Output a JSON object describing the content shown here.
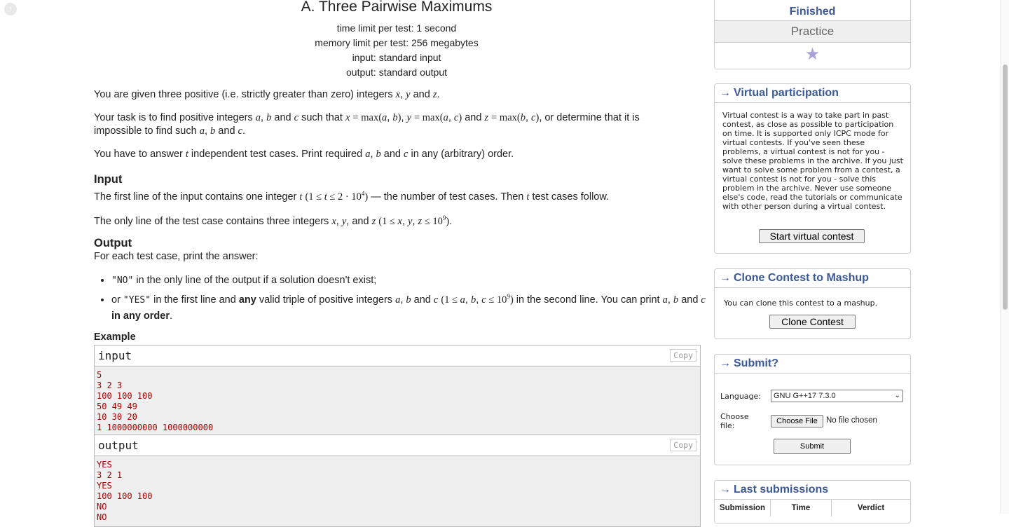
{
  "problem": {
    "title": "A. Three Pairwise Maximums",
    "limits": [
      "time limit per test: 1 second",
      "memory limit per test: 256 megabytes",
      "input: standard input",
      "output: standard output"
    ],
    "statement_1_pre": "You are given three positive (i.e. strictly greater than zero) integers ",
    "statement_2_pre": "Your task is to find positive integers ",
    "statement_2_mid": " such that ",
    "statement_2_post": ", or determine that it is impossible to find such ",
    "statement_3_pre": "You have to answer ",
    "statement_3_mid": " independent test cases. Print required ",
    "statement_3_post": " in any (arbitrary) order.",
    "input_heading": "Input",
    "input_1_pre": "The first line of the input contains one integer ",
    "input_1_post": " — the number of test cases. Then ",
    "input_1_end": " test cases follow.",
    "input_2_pre": "The only line of the test case contains three integers ",
    "output_heading": "Output",
    "output_intro": "For each test case, print the answer:",
    "bullet_1_q": "\"NO\"",
    "bullet_1_rest": " in the only line of the output if a solution doesn't exist;",
    "bullet_2_pre": "or ",
    "bullet_2_q": "\"YES\"",
    "bullet_2_a": " in the first line and ",
    "bullet_2_any": "any",
    "bullet_2_b": " valid triple of positive integers ",
    "bullet_2_c": " in the second line. You can print ",
    "bullet_2_order": "in any order",
    "example_heading": "Example",
    "input_label": "input",
    "output_label": "output",
    "copy_label": "Copy",
    "input_text": "5\n3 2 3\n100 100 100\n50 49 49\n10 30 20\n1 1000000000 1000000000",
    "output_text": "YES\n3 2 1\nYES\n100 100 100\nNO\nNO"
  },
  "sidebar": {
    "status_finished": "Finished",
    "status_practice": "Practice",
    "virtual": {
      "title": "Virtual participation",
      "text": "Virtual contest is a way to take part in past contest, as close as possible to participation on time. It is supported only ICPC mode for virtual contests. If you've seen these problems, a virtual contest is not for you - solve these problems in the archive. If you just want to solve some problem from a contest, a virtual contest is not for you - solve this problem in the archive. Never use someone else's code, read the tutorials or communicate with other person during a virtual contest.",
      "button": "Start virtual contest"
    },
    "clone": {
      "title": "Clone Contest to Mashup",
      "text": "You can clone this contest to a mashup.",
      "button": "Clone Contest"
    },
    "submit": {
      "title": "Submit?",
      "language_label": "Language:",
      "language_value": "GNU G++17 7.3.0",
      "file_label": "Choose file:",
      "file_button": "Choose File",
      "file_status": "No file chosen",
      "submit_button": "Submit"
    },
    "last": {
      "title": "Last submissions",
      "columns": [
        "Submission",
        "Time",
        "Verdict"
      ]
    }
  },
  "colors": {
    "accent": "#3b5998",
    "sample_text": "#aa0000"
  }
}
